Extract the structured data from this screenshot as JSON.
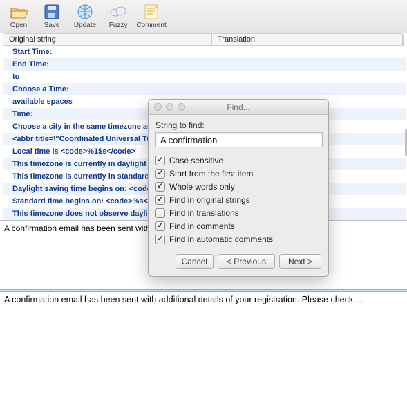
{
  "toolbar": {
    "open": {
      "label": "Open"
    },
    "save": {
      "label": "Save"
    },
    "update": {
      "label": "Update"
    },
    "fuzzy": {
      "label": "Fuzzy"
    },
    "comment": {
      "label": "Comment"
    }
  },
  "columns": {
    "original": "Original string",
    "translation": "Translation"
  },
  "rows": [
    "Start Time:",
    "End Time:",
    " to",
    "Choose a Time:",
    "available spaces",
    "Time:",
    "Choose a city in the same timezone as you.",
    " <abbr title=\\\"Coordinated Universal Time\\\">UTC</abbr>",
    "Local time is <code>%1$s</code>",
    "This timezone is currently in daylight saving time.",
    "This timezone is currently in standard time.",
    "Daylight saving time begins on: <code>%s</code>.",
    "Standard time begins  on: <code>%s</code>.",
    "This timezone does not observe daylight saving time."
  ],
  "upper_text": "A confirmation email has been sent with additional details of your registration.",
  "lower_text": "A confirmation email has been sent with additional details of your registration. Please check ...",
  "find": {
    "title": "Find...",
    "label": "String to find:",
    "value": "A confirmation",
    "options": [
      {
        "label": "Case sensitive",
        "checked": true
      },
      {
        "label": "Start from the first item",
        "checked": true
      },
      {
        "label": "Whole words only",
        "checked": true
      },
      {
        "label": "Find in original strings",
        "checked": true
      },
      {
        "label": "Find in translations",
        "checked": false
      },
      {
        "label": "Find in comments",
        "checked": true
      },
      {
        "label": "Find in automatic comments",
        "checked": true
      }
    ],
    "buttons": {
      "cancel": "Cancel",
      "prev": "< Previous",
      "next": "Next >"
    }
  }
}
